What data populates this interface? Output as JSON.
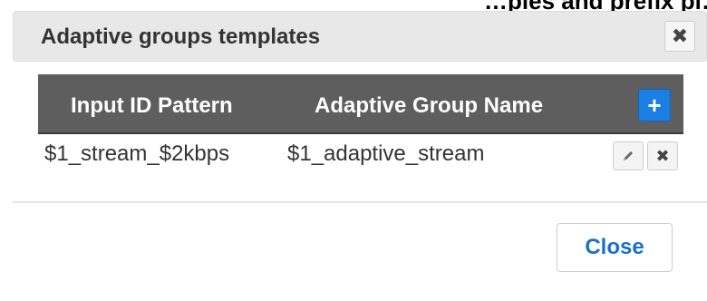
{
  "background": {
    "partial_text": "…ples and prefix pl…"
  },
  "dialog": {
    "title": "Adaptive groups templates",
    "close_icon_glyph": "✖",
    "table": {
      "headers": [
        "Input ID Pattern",
        "Adaptive Group Name"
      ],
      "add_icon_glyph": "+",
      "rows": [
        {
          "input_id_pattern": "$1_stream_$2kbps",
          "adaptive_group_name": "$1_adaptive_stream"
        }
      ],
      "row_actions": {
        "edit_icon": "pencil-icon",
        "delete_icon": "close-icon",
        "delete_glyph": "✖"
      }
    },
    "footer": {
      "close_label": "Close"
    }
  },
  "colors": {
    "header_bg": "#e8e8e8",
    "table_header_bg": "#5e5e5e",
    "accent": "#1a7fe0",
    "close_text": "#1a70c9"
  }
}
